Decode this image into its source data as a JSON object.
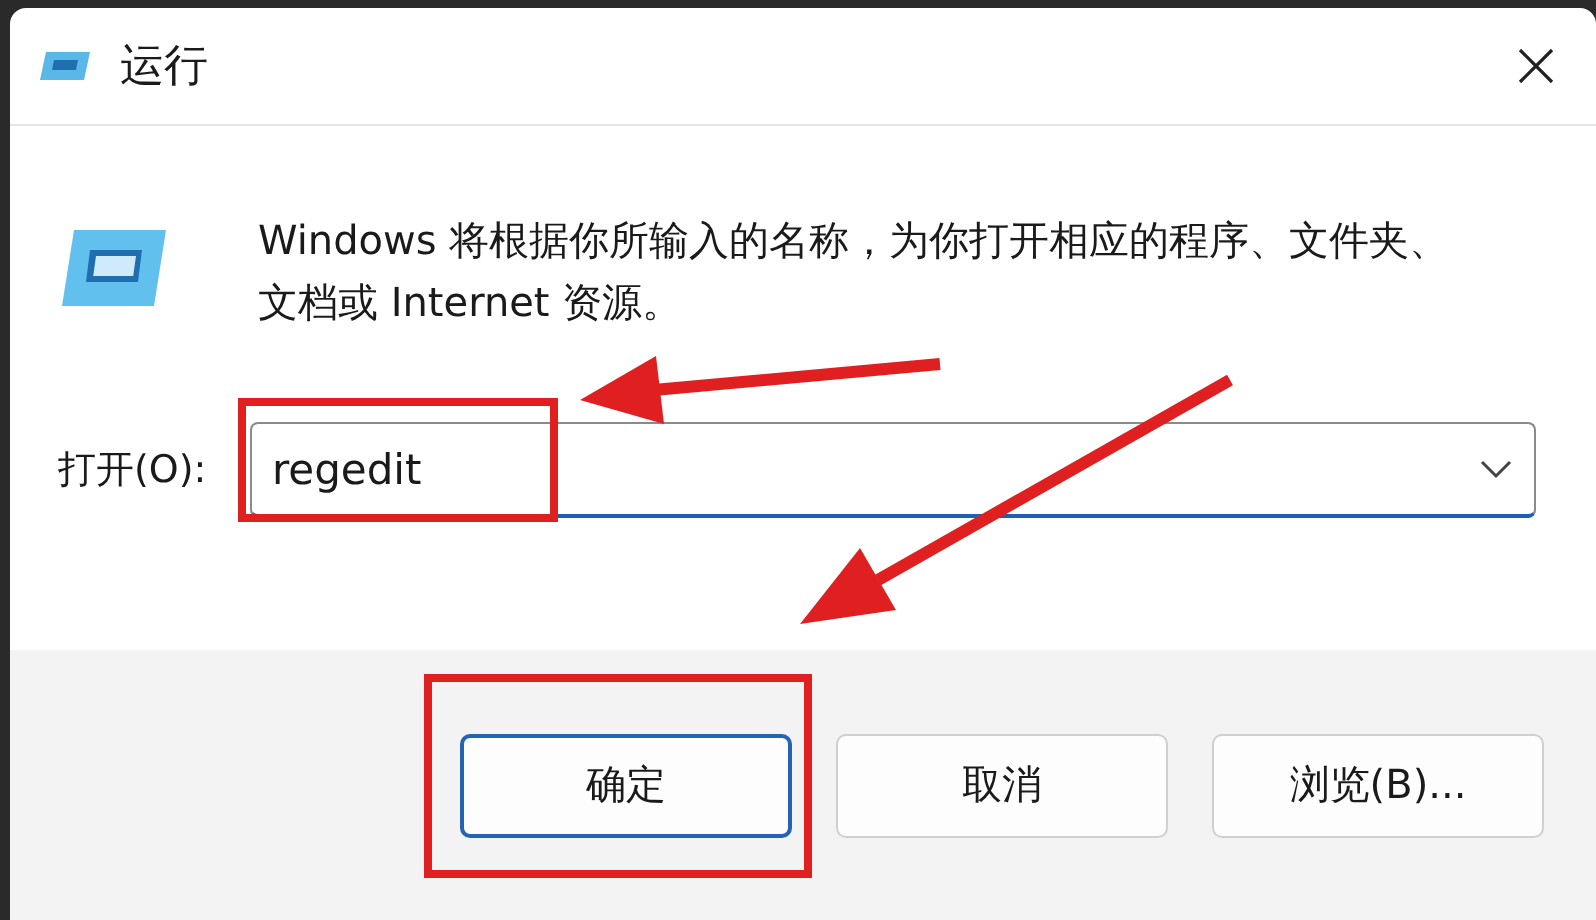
{
  "window": {
    "title": "运行"
  },
  "message": "Windows 将根据你所输入的名称，为你打开相应的程序、文件夹、文档或 Internet 资源。",
  "open_field": {
    "label": "打开(O):",
    "value": "regedit",
    "highlighted": true
  },
  "buttons": [
    {
      "label": "确定",
      "default": true,
      "highlighted": true
    },
    {
      "label": "取消",
      "default": false,
      "highlighted": false
    },
    {
      "label": "浏览(B)...",
      "default": false,
      "highlighted": false
    }
  ]
}
